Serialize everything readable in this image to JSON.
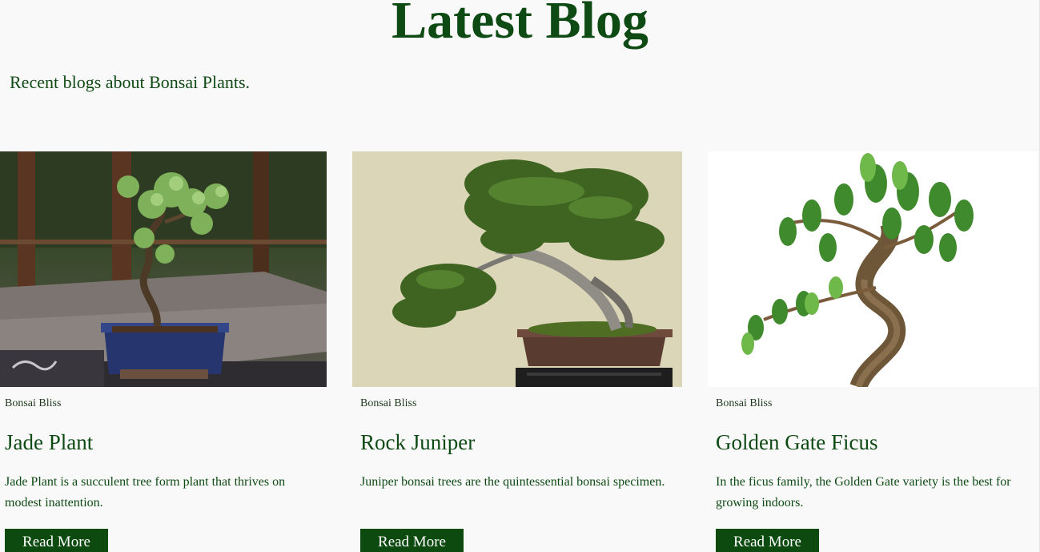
{
  "header": {
    "title": "Latest Blog",
    "subtitle": "Recent blogs about Bonsai Plants."
  },
  "posts": [
    {
      "author": "Bonsai Bliss",
      "title": "Jade Plant",
      "excerpt": "Jade Plant is a succulent tree form plant that thrives on modest inattention.",
      "button_label": "Read More",
      "image_alt": "Jade plant bonsai in a blue pot"
    },
    {
      "author": "Bonsai Bliss",
      "title": "Rock Juniper",
      "excerpt": "Juniper bonsai trees are the quintessential bonsai specimen.",
      "button_label": "Read More",
      "image_alt": "Juniper bonsai in a brown pot"
    },
    {
      "author": "Bonsai Bliss",
      "title": "Golden Gate Ficus",
      "excerpt": "In the ficus family, the Golden Gate variety is the best for growing indoors.",
      "button_label": "Read More",
      "image_alt": "Golden Gate ficus bonsai"
    }
  ],
  "colors": {
    "brand_green": "#0d4a10",
    "page_background": "#f9f9f9"
  }
}
